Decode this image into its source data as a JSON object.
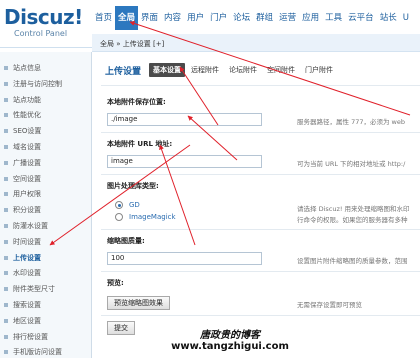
{
  "logo": {
    "title": "Discuz!",
    "subtitle": "Control Panel"
  },
  "topnav": [
    {
      "label": "首页",
      "active": false
    },
    {
      "label": "全局",
      "active": true
    },
    {
      "label": "界面",
      "active": false
    },
    {
      "label": "内容",
      "active": false
    },
    {
      "label": "用户",
      "active": false
    },
    {
      "label": "门户",
      "active": false
    },
    {
      "label": "论坛",
      "active": false
    },
    {
      "label": "群组",
      "active": false
    },
    {
      "label": "运营",
      "active": false
    },
    {
      "label": "应用",
      "active": false
    },
    {
      "label": "工具",
      "active": false
    },
    {
      "label": "云平台",
      "active": false
    },
    {
      "label": "站长",
      "active": false
    },
    {
      "label": "U",
      "active": false
    }
  ],
  "breadcrumb": "全局 » 上传设置  [+]",
  "sidebar": [
    "站点信息",
    "注册与访问控制",
    "站点功能",
    "性能优化",
    "SEO设置",
    "域名设置",
    "广播设置",
    "空间设置",
    "用户权限",
    "积分设置",
    "防灌水设置",
    "时间设置",
    "上传设置",
    "水印设置",
    "附件类型尺寸",
    "搜索设置",
    "地区设置",
    "排行榜设置",
    "手机版访问设置"
  ],
  "sidebar_active_index": 12,
  "main": {
    "section_title": "上传设置",
    "subtabs": [
      {
        "label": "基本设置",
        "active": true
      },
      {
        "label": "远程附件",
        "active": false
      },
      {
        "label": "论坛附件",
        "active": false
      },
      {
        "label": "空间附件",
        "active": false
      },
      {
        "label": "门户附件",
        "active": false
      }
    ],
    "attach_dir": {
      "label": "本地附件保存位置:",
      "value": "./image",
      "tip": "服务器路径，属性 777，必须为 web"
    },
    "attach_url": {
      "label": "本地附件 URL 地址:",
      "value": "image",
      "tip": "可为当前 URL 下的相对地址或 http:/"
    },
    "image_lib": {
      "label": "图片处理库类型:",
      "options": [
        {
          "label": "GD",
          "selected": true
        },
        {
          "label": "ImageMagick",
          "selected": false
        }
      ],
      "tip_line1": "请选择 Discuz! 用来处理缩略图和水印",
      "tip_line2": "行命令的权限。如果您的服务器有多种"
    },
    "thumb_quality": {
      "label": "缩略图质量:",
      "value": "100",
      "tip": "设置图片附件缩略图的质量参数，范围"
    },
    "preview": {
      "label": "预览:",
      "button": "预览缩略图效果",
      "tip": "无需保存设置即可预览"
    },
    "submit": "提交"
  },
  "watermark": {
    "line1": "唐政贵的博客",
    "line2": "www.tangzhigui.com"
  },
  "colors": {
    "accent": "#2c78bf",
    "arrow": "#e0202a",
    "link": "#1d5f9e"
  }
}
